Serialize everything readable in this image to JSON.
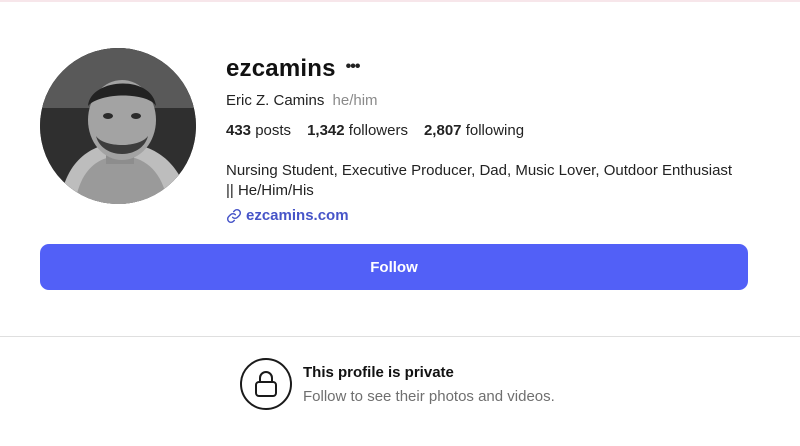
{
  "profile": {
    "username": "ezcamins",
    "more_icon": "more-horizontal-icon",
    "full_name": "Eric Z. Camins",
    "pronouns": "he/him",
    "avatar_description": "profile-photo",
    "stats": {
      "posts_count": "433",
      "posts_label": "posts",
      "followers_count": "1,342",
      "followers_label": "followers",
      "following_count": "2,807",
      "following_label": "following"
    },
    "bio": "Nursing Student, Executive Producer, Dad, Music Lover, Outdoor Enthusiast || He/Him/His",
    "link_icon": "link-icon",
    "website": "ezcamins.com"
  },
  "actions": {
    "follow_label": "Follow"
  },
  "private_notice": {
    "icon": "lock-icon",
    "title": "This profile is private",
    "subtitle": "Follow to see their photos and videos."
  },
  "colors": {
    "accent": "#5260f7",
    "link": "#4654c8",
    "muted_text": "#6f6f6f",
    "divider": "#dfdfdf"
  }
}
